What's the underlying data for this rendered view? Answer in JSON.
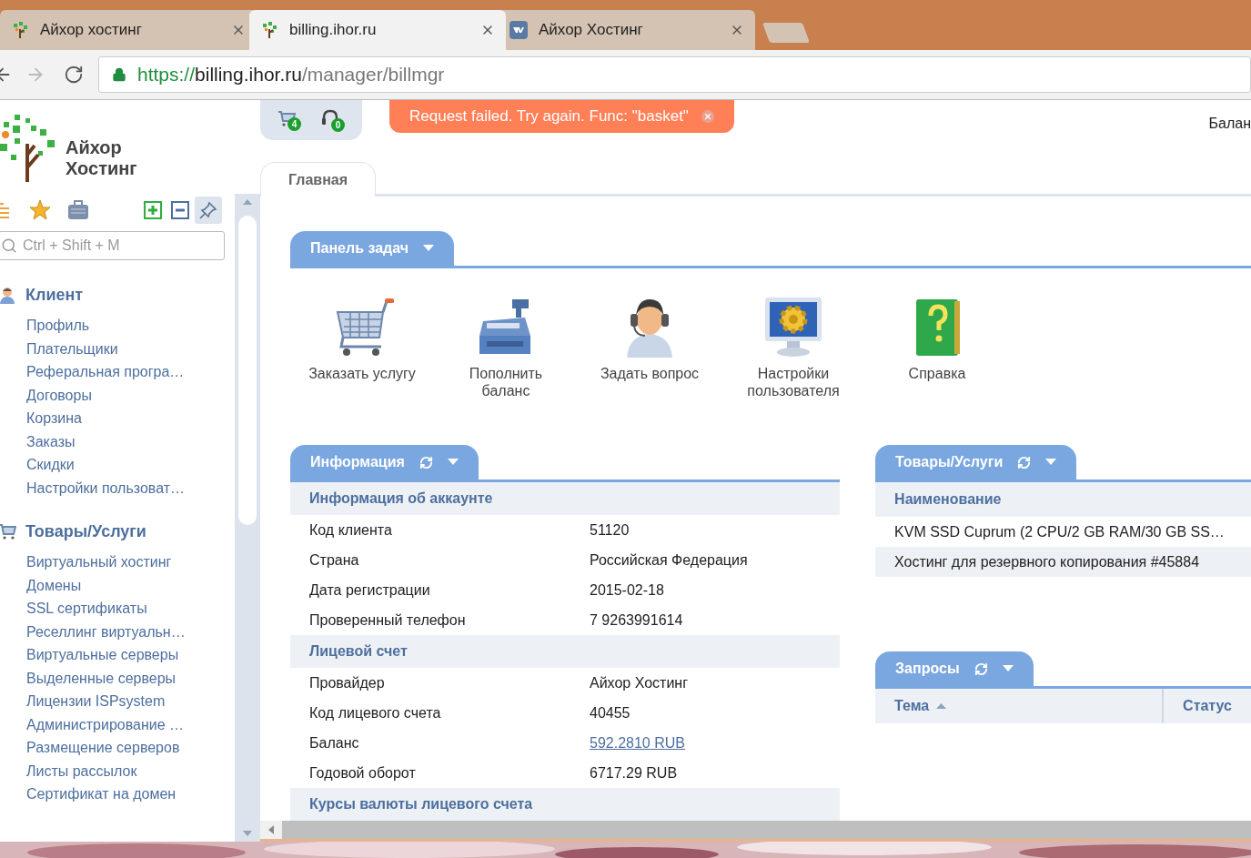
{
  "browser": {
    "tabs": [
      {
        "title": "Айхор хостинг",
        "kind": "tree",
        "selected": false
      },
      {
        "title": "billing.ihor.ru",
        "kind": "tree",
        "selected": true
      },
      {
        "title": "Айхор Хостинг",
        "kind": "vk",
        "selected": false
      }
    ],
    "url": {
      "scheme": "https://",
      "host": "billing.ihor.ru",
      "path": "/manager/billmgr"
    }
  },
  "header": {
    "cart_count": "4",
    "support_count": "0",
    "error": "Request failed. Try again. Func: \"basket\"",
    "balance_label": "Балан"
  },
  "logo": {
    "line1": "Айхор",
    "line2": "Хостинг"
  },
  "sidebar": {
    "search": {
      "placeholder": "Ctrl + Shift + M"
    },
    "sections": [
      {
        "title": "Клиент",
        "kind": "user",
        "items": [
          "Профиль",
          "Плательщики",
          "Реферальная програ…",
          "Договоры",
          "Корзина",
          "Заказы",
          "Скидки",
          "Настройки пользоват…"
        ]
      },
      {
        "title": "Товары/Услуги",
        "kind": "cart",
        "items": [
          "Виртуальный хостинг",
          "Домены",
          "SSL сертификаты",
          "Реселлинг виртуальн…",
          "Виртуальные серверы",
          "Выделенные серверы",
          "Лицензии ISPsystem",
          "Администрирование …",
          "Размещение серверов",
          "Листы рассылок",
          "Сертификат на домен"
        ]
      }
    ]
  },
  "tabs": [
    {
      "label": "Главная",
      "selected": true
    }
  ],
  "task_panel": {
    "title": "Панель задач",
    "items": [
      {
        "label": "Заказать услугу",
        "kind": "cart"
      },
      {
        "label": "Пополнить баланс",
        "kind": "register"
      },
      {
        "label": "Задать вопрос",
        "kind": "support"
      },
      {
        "label": "Настройки пользователя",
        "kind": "settings"
      },
      {
        "label": "Справка",
        "kind": "help"
      }
    ]
  },
  "info": {
    "title": "Информация",
    "sections": [
      {
        "title": "Информация об аккаунте",
        "rows": [
          {
            "label": "Код клиента",
            "value": "51120"
          },
          {
            "label": "Страна",
            "value": "Российская Федерация"
          },
          {
            "label": "Дата регистрации",
            "value": "2015-02-18"
          },
          {
            "label": "Проверенный телефон",
            "value": "7 9263991614"
          }
        ]
      },
      {
        "title": "Лицевой счет",
        "rows": [
          {
            "label": "Провайдер",
            "value": "Айхор Хостинг"
          },
          {
            "label": "Код лицевого счета",
            "value": "40455"
          },
          {
            "label": "Баланс",
            "value": "592.2810 RUB",
            "kind": "link"
          },
          {
            "label": "Годовой оборот",
            "value": "6717.29 RUB"
          }
        ]
      },
      {
        "title": "Курсы валюты лицевого счета"
      }
    ]
  },
  "products": {
    "title": "Товары/Услуги",
    "column": "Наименование",
    "rows": [
      "KVM SSD Cuprum (2 CPU/2 GB RAM/30 GB SS…",
      "Хостинг для резервного копирования #45884"
    ]
  },
  "requests": {
    "title": "Запросы",
    "columns": [
      {
        "label": "Тема",
        "sorted": true
      },
      {
        "label": "Статус",
        "sorted": false
      }
    ]
  }
}
